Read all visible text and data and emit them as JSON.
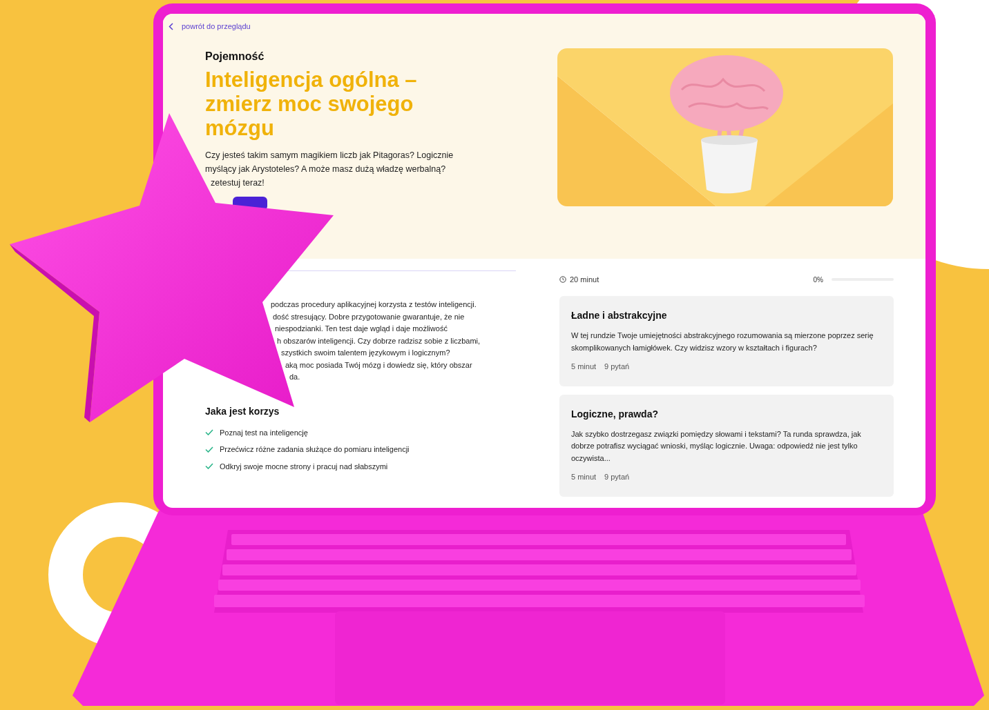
{
  "back_link": "powrót do przeglądu",
  "category": "Pojemność",
  "title": "Inteligencja ogólna – zmierz moc swojego mózgu",
  "intro": "Czy jesteś takim samym magikiem liczb jak Pitagoras? Logicznie myślący jak Arystoteles? A może masz dużą władzę werbalną?",
  "intro_tail": "zetestuj teraz!",
  "description_lines": [
    "podczas procedury aplikacyjnej korzysta z testów inteligencji.",
    "dość stresujący. Dobre przygotowanie gwarantuje, że nie",
    "niespodzianki. Ten test daje wgląd i daje możliwość",
    "h obszarów inteligencji. Czy dobrze radzisz sobie z liczbami,",
    "szystkich swoim talentem językowym i logicznym?",
    "aką moc posiada Twój mózg i dowiedz się, który obszar",
    "da."
  ],
  "benefits": {
    "heading": "Jaka jest korzys",
    "items": [
      "Poznaj test na inteligencję",
      "Przećwicz różne zadania służące do pomiaru inteligencji",
      "Odkryj swoje mocne strony i pracuj nad słabszymi"
    ]
  },
  "duration": "20 minut",
  "progress": {
    "reading": "0%",
    "level": 0
  },
  "rounds": [
    {
      "title": "Ładne i abstrakcyjne",
      "description": "W tej rundzie Twoje umiejętności abstrakcyjnego rozumowania są mierzone poprzez serię skomplikowanych łamigłówek. Czy widzisz wzory w kształtach i figurach?",
      "duration": "5 minut",
      "questions": "9 pytań"
    },
    {
      "title": "Logiczne, prawda?",
      "description": "Jak szybko dostrzegasz związki pomiędzy słowami i tekstami? Ta runda sprawdza, jak dobrze potrafisz wyciągać wnioski, myśląc logicznie. Uwaga: odpowiedź nie jest tylko oczywista...",
      "duration": "5 minut",
      "questions": "9 pytań"
    }
  ]
}
